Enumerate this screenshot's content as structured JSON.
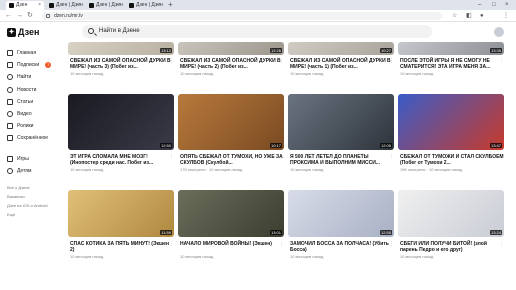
{
  "browser": {
    "tabs": [
      {
        "title": "Дзен"
      },
      {
        "title": "Дзен | Дзен"
      },
      {
        "title": "Дзен | Дзен"
      },
      {
        "title": "Дзен | Дзен"
      }
    ],
    "url": "dzen.ru/mr.tv"
  },
  "sidebar": {
    "logo_text": "Дзен",
    "items": [
      {
        "label": "Главная",
        "icon": "home-icon"
      },
      {
        "label": "Подписки",
        "icon": "subscriptions-icon",
        "badge": "7"
      },
      {
        "label": "Найти",
        "icon": "search-icon"
      },
      {
        "label": "Новости",
        "icon": "news-icon"
      },
      {
        "label": "Статьи",
        "icon": "articles-icon"
      },
      {
        "label": "Видео",
        "icon": "video-icon"
      },
      {
        "label": "Ролики",
        "icon": "clips-icon"
      },
      {
        "label": "Сохранённое",
        "icon": "bookmark-icon"
      },
      {
        "label": "Игры",
        "icon": "games-icon"
      },
      {
        "label": "Детям",
        "icon": "kids-icon"
      }
    ],
    "footer_links": [
      "Всё о Дзене",
      "Вакансии",
      "Дзен на iOS и Android",
      "Ещё"
    ]
  },
  "search": {
    "placeholder": "Найти в Дзене"
  },
  "cards": [
    {
      "title": "СВЕЖАЛ ИЗ САМОЙ ОПАСНОЙ ДУРКИ В МИРЕ! (часть 3) (Побег из...",
      "meta": "10 месяцев назад",
      "duration": "13:12",
      "colors": [
        "#d8d2c4",
        "#b8b0a0"
      ]
    },
    {
      "title": "СВЕЖАЛ ИЗ САМОЙ ОПАСНОЙ ДУРКИ В МИРЕ! (часть 2) (Побег из...",
      "meta": "10 месяцев назад",
      "duration": "12:26",
      "colors": [
        "#c8c4bc",
        "#9c968c"
      ]
    },
    {
      "title": "СВЕЖАЛ ИЗ САМОЙ ОПАСНОЙ ДУРКИ В МИРЕ! (часть 1) (Побег из...",
      "meta": "10 месяцев назад",
      "duration": "10:27",
      "colors": [
        "#d0ccc4",
        "#a8a49c"
      ]
    },
    {
      "title": "ПОСЛЕ ЭТОЙ ИГРЫ Я НЕ СМОГУ НЕ СМАТЕРИТСЯ! ЭТА ИГРА МЕНЯ ЗА...",
      "meta": "10 месяцев назад",
      "duration": "13:35",
      "colors": [
        "#c4c8cc",
        "#8c9096"
      ]
    },
    {
      "title": "ЭТ ИГРА СЛОМАЛА МНЕ МОЗГ! (Инопостер среди нас. Побег из...",
      "meta": "10 месяцев назад",
      "duration": "12:50",
      "colors": [
        "#1a1a22",
        "#3a3a48"
      ]
    },
    {
      "title": "ОПЯТЬ СБЕЖАЛ ОТ ТУМОХИ, НО УЖЕ ЗА СКУЛБОВ (Скулбой...",
      "meta": "17К смотрели · 10 месяцев назад",
      "duration": "10:17",
      "colors": [
        "#b87a3c",
        "#7a4a22"
      ]
    },
    {
      "title": "Я 500 ЛЕТ ЛЕТЕЛ ДО ПЛАНЕТЫ ПРОКСИМА И ВЫПОЛНИМ МИССИ...",
      "meta": "10 месяцев назад",
      "duration": "12:05",
      "colors": [
        "#6a7480",
        "#2e343c"
      ]
    },
    {
      "title": "СБЕЖАЛ ОТ ТУМОЖИ И СТАЛ СКУЛБОЕМ (Побег от Тумохи 2...",
      "meta": "19К смотрели · 10 месяцев назад",
      "duration": "13:47",
      "colors": [
        "#3a5cc8",
        "#c83a2a"
      ]
    },
    {
      "title": "СПАС КОТИКА ЗА ПЯТЬ МИНУТ! (Экшен 2)",
      "meta": "10 месяцев назад",
      "duration": "11:59",
      "colors": [
        "#e0c078",
        "#b08840"
      ]
    },
    {
      "title": "НАЧАЛО МИРОВОЙ ВОЙНЫ! (Экшен)",
      "meta": "10 месяцев назад",
      "duration": "13:01",
      "colors": [
        "#6a6e5a",
        "#3c3e30"
      ]
    },
    {
      "title": "ЗАМОЧИЛ БОССА ЗА ПОЛЧАСА! (Убить Босса)",
      "meta": "10 месяцев назад",
      "duration": "12:55",
      "colors": [
        "#d8dce8",
        "#a8b0c4"
      ]
    },
    {
      "title": "СБЕГИ ИЛИ ПОЛУЧИ БИТОЙ! (злой парень Педро и его друг)",
      "meta": "10 месяцев назад",
      "duration": "13:24",
      "colors": [
        "#f0f0f0",
        "#c8ccd4"
      ]
    }
  ]
}
